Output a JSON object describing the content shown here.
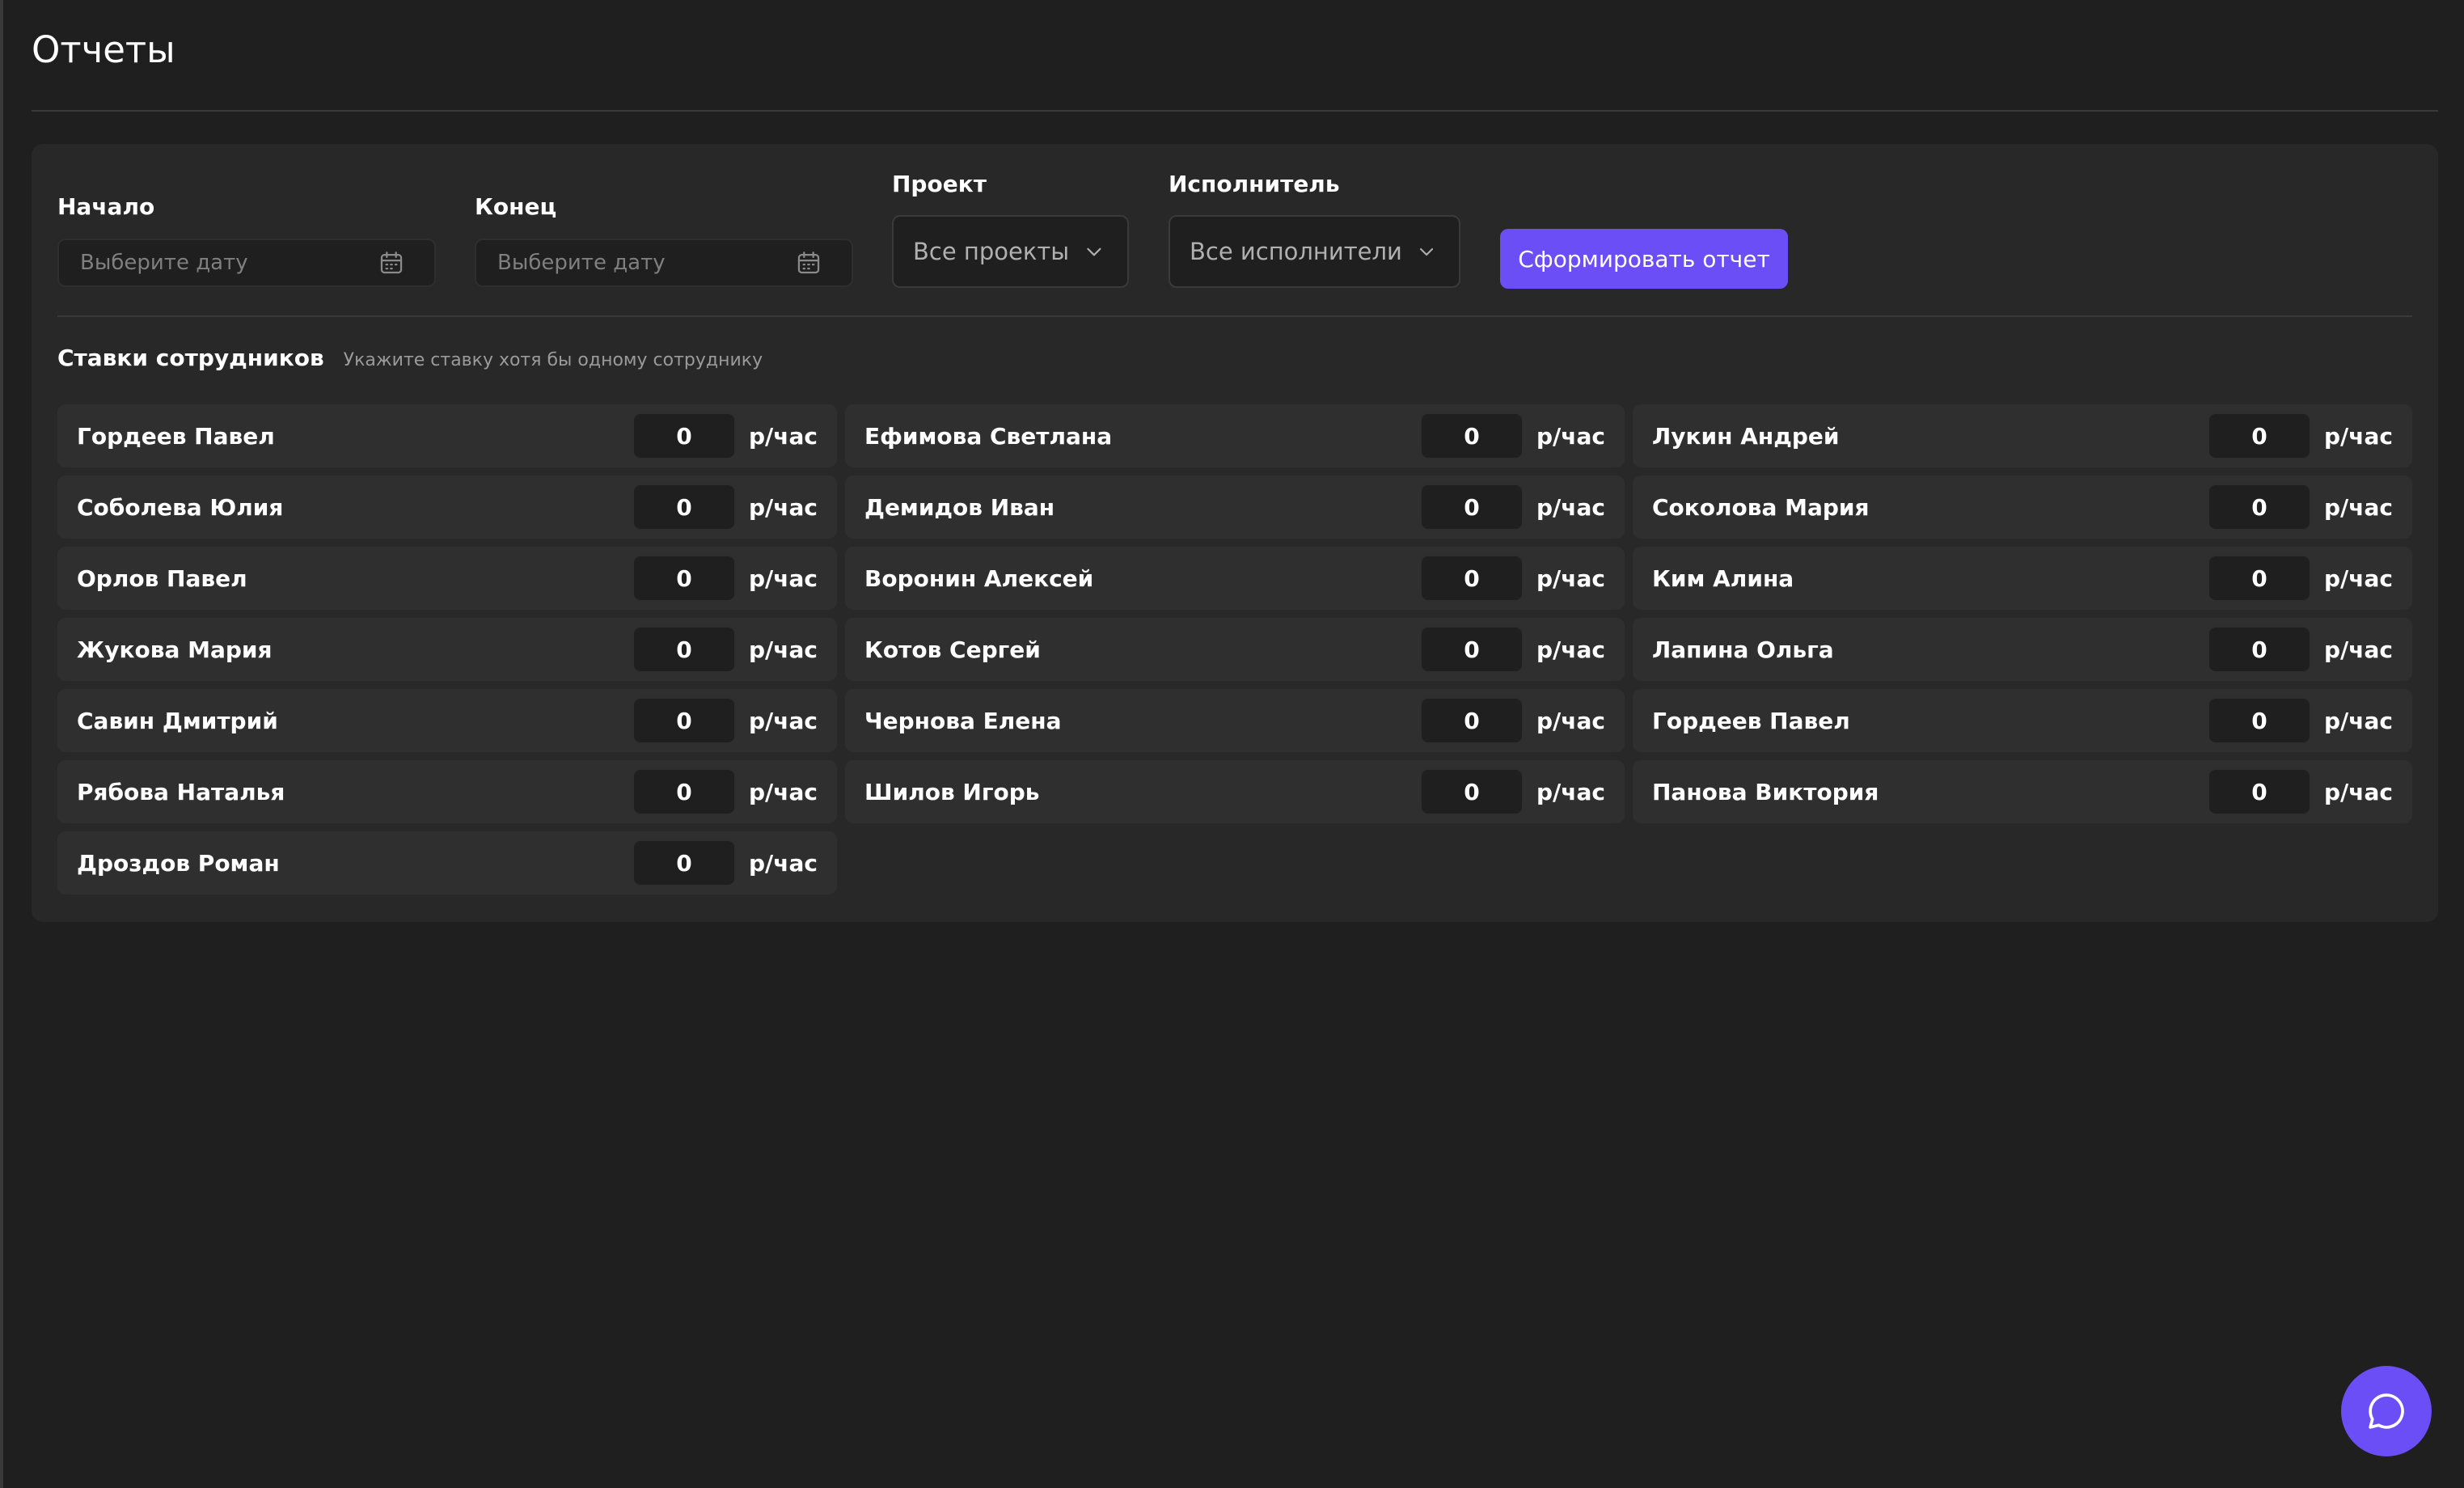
{
  "header": {
    "title": "Отчеты"
  },
  "filters": {
    "start": {
      "label": "Начало",
      "placeholder": "Выберите дату",
      "icon": "calendar-icon"
    },
    "end": {
      "label": "Конец",
      "placeholder": "Выберите дату",
      "icon": "calendar-icon"
    },
    "project": {
      "label": "Проект",
      "value": "Все проекты",
      "icon": "chevron-down-icon"
    },
    "assignee": {
      "label": "Исполнитель",
      "value": "Все исполнители",
      "icon": "chevron-down-icon"
    },
    "submit_label": "Сформировать отчет"
  },
  "rates": {
    "title": "Ставки сотрудников",
    "hint": "Укажите ставку хотя бы одному сотруднику",
    "unit": "р/час",
    "employees": [
      {
        "name": "Гордеев Павел",
        "rate": "0"
      },
      {
        "name": "Ефимова Светлана",
        "rate": "0"
      },
      {
        "name": "Лукин Андрей",
        "rate": "0"
      },
      {
        "name": "Соболева Юлия",
        "rate": "0"
      },
      {
        "name": "Демидов Иван",
        "rate": "0"
      },
      {
        "name": "Соколова Мария",
        "rate": "0"
      },
      {
        "name": "Орлов Павел",
        "rate": "0"
      },
      {
        "name": "Воронин Алексей",
        "rate": "0"
      },
      {
        "name": "Ким Алина",
        "rate": "0"
      },
      {
        "name": "Жукова Мария",
        "rate": "0"
      },
      {
        "name": "Котов Сергей",
        "rate": "0"
      },
      {
        "name": "Лапина Ольга",
        "rate": "0"
      },
      {
        "name": "Савин Дмитрий",
        "rate": "0"
      },
      {
        "name": "Чернова Елена",
        "rate": "0"
      },
      {
        "name": "Гордеев Павел",
        "rate": "0"
      },
      {
        "name": "Рябова Наталья",
        "rate": "0"
      },
      {
        "name": "Шилов Игорь",
        "rate": "0"
      },
      {
        "name": "Панова Виктория",
        "rate": "0"
      },
      {
        "name": "Дроздов Роман",
        "rate": "0"
      }
    ]
  },
  "chat": {
    "icon": "chat-bubble-icon"
  },
  "colors": {
    "background": "#1f1f1f",
    "panel": "#282828",
    "row": "#2f2f2f",
    "accent": "#6b4ef6"
  }
}
